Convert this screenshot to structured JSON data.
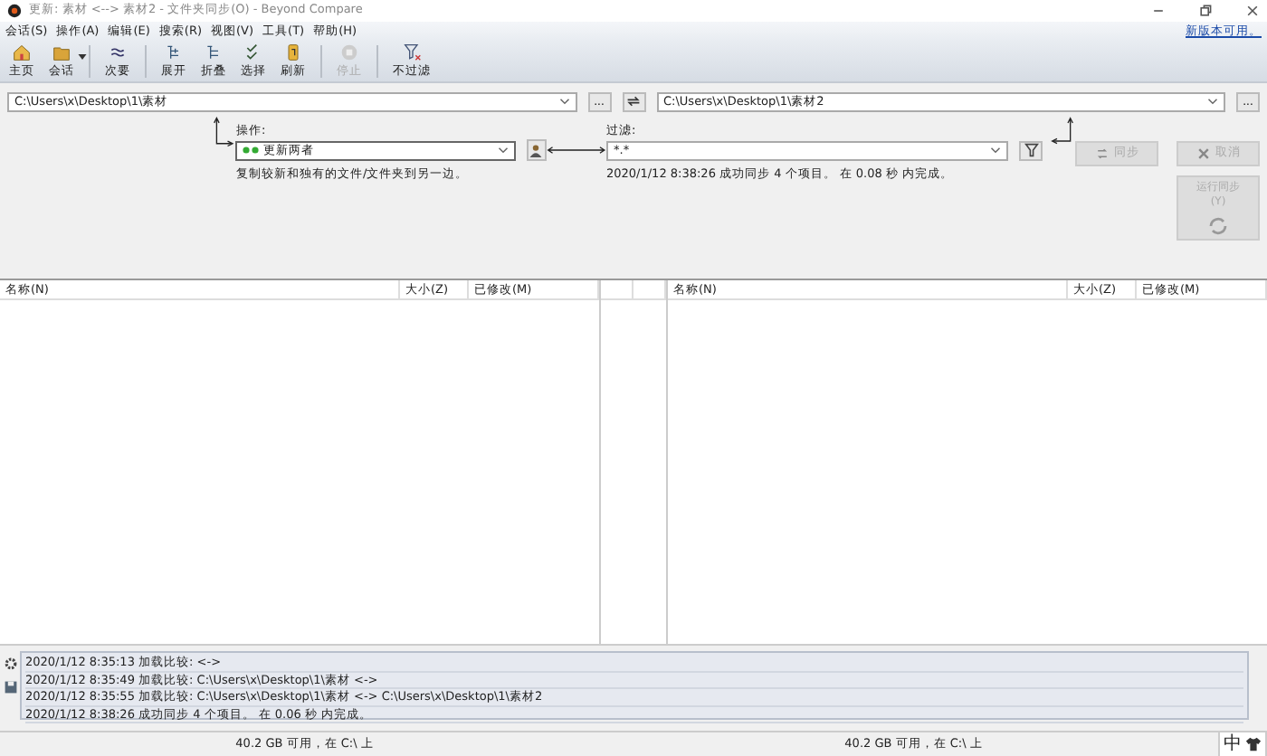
{
  "window": {
    "title": "更新: 素材 <--> 素材2 - 文件夹同步(O) - Beyond Compare"
  },
  "menu": [
    "会话(S)",
    "操作(A)",
    "编辑(E)",
    "搜索(R)",
    "视图(V)",
    "工具(T)",
    "帮助(H)"
  ],
  "update_link": "新版本可用。",
  "toolbar": [
    {
      "kind": "home",
      "label": "主页",
      "disabled": false,
      "dropdown": false
    },
    {
      "kind": "folder",
      "label": "会话",
      "disabled": false,
      "dropdown": true
    },
    {
      "kind": "next",
      "label": "次要",
      "disabled": false,
      "dropdown": false
    },
    {
      "kind": "expand",
      "label": "展开",
      "disabled": false,
      "dropdown": false
    },
    {
      "kind": "collapse",
      "label": "折叠",
      "disabled": false,
      "dropdown": false
    },
    {
      "kind": "select",
      "label": "选择",
      "disabled": false,
      "dropdown": false
    },
    {
      "kind": "refresh",
      "label": "刷新",
      "disabled": false,
      "dropdown": false
    },
    {
      "kind": "stop",
      "label": "停止",
      "disabled": true,
      "dropdown": false
    },
    {
      "kind": "filter",
      "label": "不过滤",
      "disabled": false,
      "dropdown": false
    }
  ],
  "left_path": "C:\\Users\\x\\Desktop\\1\\素材",
  "right_path": "C:\\Users\\x\\Desktop\\1\\素材2",
  "browse_buttons": [
    "...",
    "..."
  ],
  "operation": {
    "label": "操作:",
    "value": "更新两者",
    "description": "复制较新和独有的文件/文件夹到另一边。"
  },
  "filter": {
    "label": "过滤:",
    "value": "*.*"
  },
  "status": "2020/1/12 8:38:26  成功同步 4 个项目。 在 0.08 秒 内完成。",
  "action_buttons": [
    {
      "kind": "sync",
      "label": "同步",
      "disabled": true
    },
    {
      "kind": "cancel",
      "label": "取消",
      "disabled": true
    }
  ],
  "run_button": {
    "label": "运行同步(Y)",
    "disabled": true
  },
  "left_columns": [
    "名称(N)",
    "大小(Z)",
    "已修改(M)"
  ],
  "right_columns": [
    "名称(N)",
    "大小(Z)",
    "已修改(M)"
  ],
  "log": [
    "2020/1/12 8:35:13  加载比较: <->",
    "2020/1/12 8:35:49  加载比较: C:\\Users\\x\\Desktop\\1\\素材 <->",
    "2020/1/12 8:35:55  加载比较: C:\\Users\\x\\Desktop\\1\\素材 <-> C:\\Users\\x\\Desktop\\1\\素材2",
    "2020/1/12 8:38:26  成功同步 4 个项目。  在 0.06 秒 内完成。"
  ],
  "status_bar": {
    "left": "40.2 GB 可用，在 C:\\ 上",
    "right": "40.2 GB 可用，在 C:\\ 上"
  },
  "ime": {
    "label": "中"
  }
}
